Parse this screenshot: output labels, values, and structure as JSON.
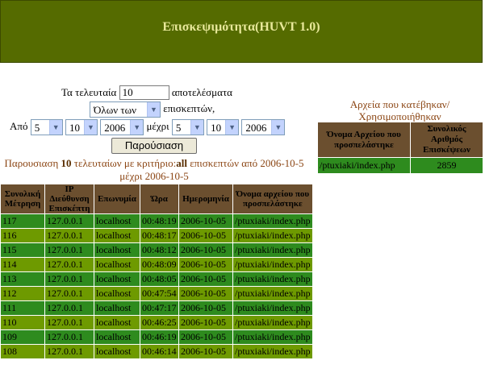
{
  "header": {
    "title": "Επισκεψιμότητα(HUVT 1.0)"
  },
  "form": {
    "last_label": "Τα τελευταία",
    "last_value": "10",
    "results_label": "αποτελέσματα",
    "visitor_filter": "Όλων των",
    "visitors_label": "επισκεπτών,",
    "from_label": "Από",
    "until_label": "μέχρι",
    "from_day": "5",
    "from_month": "10",
    "from_year": "2006",
    "to_day": "5",
    "to_month": "10",
    "to_year": "2006",
    "submit_label": "Παρούσιαση"
  },
  "summary": {
    "prefix": "Παρουσιαση",
    "count": "10",
    "middle": "τελευταίων με κριτήριο:",
    "criterion": "all",
    "suffix": "επισκεπτών από 2006-10-5 μέχρι 2006-10-5"
  },
  "visits": {
    "headers": [
      "Συνολική Μέτρηση",
      "IP Διεύθυνση Επισκέπτη",
      "Επωνυμία",
      "Ώρα",
      "Ημερομηνία",
      "Όνομα αρχείου που προσπελάστηκε"
    ],
    "rows": [
      [
        "117",
        "127.0.0.1",
        "localhost",
        "00:48:19",
        "2006-10-05",
        "/ptuxiaki/index.php"
      ],
      [
        "116",
        "127.0.0.1",
        "localhost",
        "00:48:17",
        "2006-10-05",
        "/ptuxiaki/index.php"
      ],
      [
        "115",
        "127.0.0.1",
        "localhost",
        "00:48:12",
        "2006-10-05",
        "/ptuxiaki/index.php"
      ],
      [
        "114",
        "127.0.0.1",
        "localhost",
        "00:48:09",
        "2006-10-05",
        "/ptuxiaki/index.php"
      ],
      [
        "113",
        "127.0.0.1",
        "localhost",
        "00:48:05",
        "2006-10-05",
        "/ptuxiaki/index.php"
      ],
      [
        "112",
        "127.0.0.1",
        "localhost",
        "00:47:54",
        "2006-10-05",
        "/ptuxiaki/index.php"
      ],
      [
        "111",
        "127.0.0.1",
        "localhost",
        "00:47:17",
        "2006-10-05",
        "/ptuxiaki/index.php"
      ],
      [
        "110",
        "127.0.0.1",
        "localhost",
        "00:46:25",
        "2006-10-05",
        "/ptuxiaki/index.php"
      ],
      [
        "109",
        "127.0.0.1",
        "localhost",
        "00:46:19",
        "2006-10-05",
        "/ptuxiaki/index.php"
      ],
      [
        "108",
        "127.0.0.1",
        "localhost",
        "00:46:14",
        "2006-10-05",
        "/ptuxiaki/index.php"
      ]
    ]
  },
  "files": {
    "title": "Αρχεία που κατέβηκαν/Χρησιμοποιήθηκαν",
    "headers": [
      "Όνομα Αρχείου που προσπελάστηκε",
      "Συνολικός Αριθμός Επισκέψεων"
    ],
    "rows": [
      [
        "/ptuxiaki/index.php",
        "2859"
      ]
    ]
  },
  "colors": {
    "header_bg": "#556b00",
    "header_text": "#e8e89a",
    "row_green": "#2e8b1e",
    "row_olive": "#6e9a00",
    "table_header": "#6b4f2f",
    "accent_text": "#8b4513"
  }
}
